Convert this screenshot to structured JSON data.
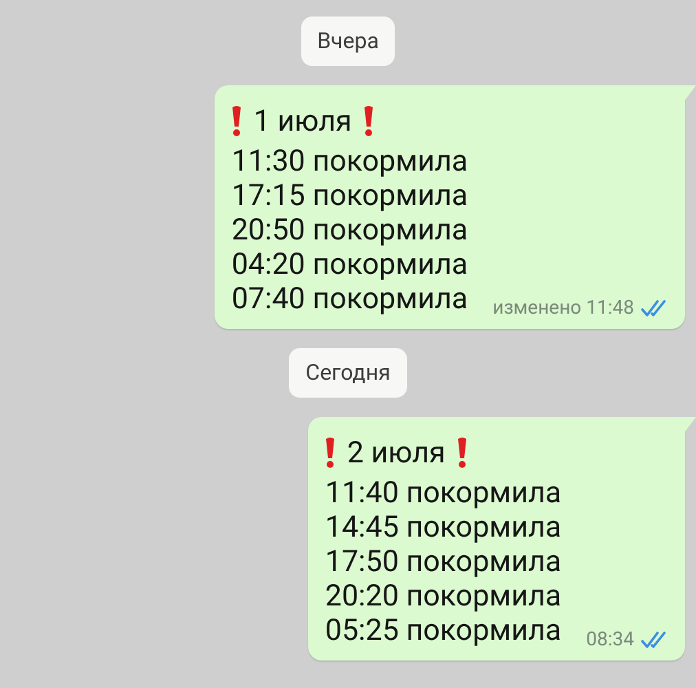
{
  "messages": [
    {
      "day": "Вчера",
      "title": "1 июля",
      "lines": [
        "11:30 покормила",
        "17:15 покормила",
        "20:50 покормила",
        "04:20 покормила",
        "07:40 покормила"
      ],
      "time": "изменено 11:48",
      "read": true
    },
    {
      "day": "Сегодня",
      "title": "2 июля",
      "lines": [
        "11:40 покормила",
        "14:45 покормила",
        "17:50 покормила",
        "20:20 покормила",
        "05:25 покормила"
      ],
      "time": "08:34",
      "read": true
    }
  ]
}
